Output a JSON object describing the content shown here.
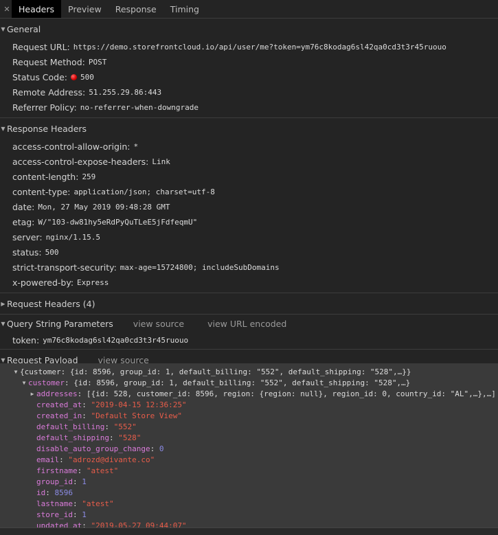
{
  "tabs": {
    "close_glyph": "✕",
    "items": [
      "Headers",
      "Preview",
      "Response",
      "Timing"
    ]
  },
  "general": {
    "title": "General",
    "request_url_label": "Request URL:",
    "request_url": "https://demo.storefrontcloud.io/api/user/me?token=ym76c8kodag6sl42qa0cd3t3r45ruouo",
    "method_label": "Request Method:",
    "method": "POST",
    "status_label": "Status Code:",
    "status": "500",
    "status_color": "#d40000",
    "remote_label": "Remote Address:",
    "remote": "51.255.29.86:443",
    "referrer_label": "Referrer Policy:",
    "referrer": "no-referrer-when-downgrade"
  },
  "response_headers": {
    "title": "Response Headers",
    "rows": [
      {
        "k": "access-control-allow-origin:",
        "v": "*"
      },
      {
        "k": "access-control-expose-headers:",
        "v": "Link"
      },
      {
        "k": "content-length:",
        "v": "259"
      },
      {
        "k": "content-type:",
        "v": "application/json; charset=utf-8"
      },
      {
        "k": "date:",
        "v": "Mon, 27 May 2019 09:48:28 GMT"
      },
      {
        "k": "etag:",
        "v": "W/\"103-dw81hy5eRdPyQuTLeE5jFdfeqmU\""
      },
      {
        "k": "server:",
        "v": "nginx/1.15.5"
      },
      {
        "k": "status:",
        "v": "500"
      },
      {
        "k": "strict-transport-security:",
        "v": "max-age=15724800; includeSubDomains"
      },
      {
        "k": "x-powered-by:",
        "v": "Express"
      }
    ]
  },
  "request_headers": {
    "title": "Request Headers (4)"
  },
  "query": {
    "title": "Query String Parameters",
    "view_source": "view source",
    "view_url_encoded": "view URL encoded",
    "token_label": "token:",
    "token": "ym76c8kodag6sl42qa0cd3t3r45ruouo"
  },
  "payload": {
    "title": "Request Payload",
    "view_source": "view source",
    "root_line": "{customer: {id: 8596, group_id: 1, default_billing: \"552\", default_shipping: \"528\",…}}",
    "customer_key": "customer",
    "customer_summary": "{id: 8596, group_id: 1, default_billing: \"552\", default_shipping: \"528\",…}",
    "addresses_key": "addresses",
    "addresses_summary": "[{id: 528, customer_id: 8596, region: {region: null}, region_id: 0, country_id: \"AL\",…},…]",
    "fields": [
      {
        "k": "created_at",
        "v": "\"2019-04-15 12:36:25\"",
        "t": "s"
      },
      {
        "k": "created_in",
        "v": "\"Default Store View\"",
        "t": "s"
      },
      {
        "k": "default_billing",
        "v": "\"552\"",
        "t": "s"
      },
      {
        "k": "default_shipping",
        "v": "\"528\"",
        "t": "s"
      },
      {
        "k": "disable_auto_group_change",
        "v": "0",
        "t": "n"
      },
      {
        "k": "email",
        "v": "\"adrozd@divante.co\"",
        "t": "s"
      },
      {
        "k": "firstname",
        "v": "\"atest\"",
        "t": "s"
      },
      {
        "k": "group_id",
        "v": "1",
        "t": "n"
      },
      {
        "k": "id",
        "v": "8596",
        "t": "n"
      },
      {
        "k": "lastname",
        "v": "\"atest\"",
        "t": "s"
      },
      {
        "k": "store_id",
        "v": "1",
        "t": "n"
      },
      {
        "k": "updated_at",
        "v": "\"2019-05-27 09:44:07\"",
        "t": "s"
      }
    ]
  }
}
